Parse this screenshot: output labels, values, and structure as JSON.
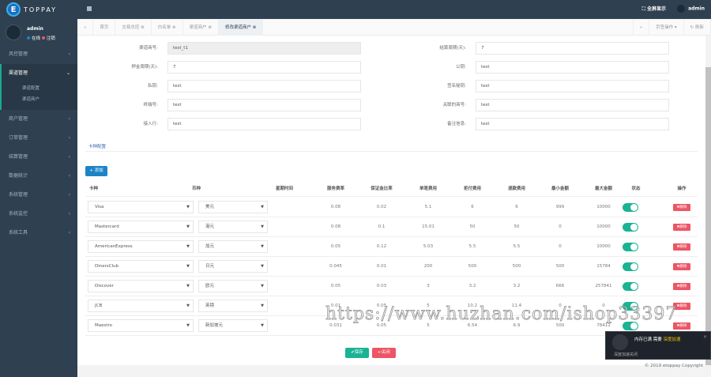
{
  "header": {
    "brand": "TOPPAY",
    "brand_letter": "E",
    "fullscreen": "⛶ 全屏显示",
    "user": "admin"
  },
  "sidebar": {
    "user": "admin",
    "online": "在线",
    "logout": "注销",
    "items": [
      {
        "label": "风控管理",
        "icon": "shield-icon"
      },
      {
        "label": "渠道管理",
        "icon": "card-icon",
        "children": [
          "渠道配置",
          "渠道商户"
        ]
      },
      {
        "label": "商户管理",
        "icon": "store-icon"
      },
      {
        "label": "订单管理",
        "icon": "cart-icon"
      },
      {
        "label": "结算管理",
        "icon": "calc-icon"
      },
      {
        "label": "数据统计",
        "icon": "chart-icon"
      },
      {
        "label": "系统管理",
        "icon": "gear-icon"
      },
      {
        "label": "系统监控",
        "icon": "monitor-icon"
      },
      {
        "label": "系统工具",
        "icon": "tool-icon"
      }
    ]
  },
  "tabs": {
    "items": [
      "首页",
      "交易总控",
      "白名单",
      "渠道商户",
      "修改渠道商户"
    ],
    "page_ops": "页签操作 ▾",
    "refresh": "↻ 刷新"
  },
  "form": {
    "left": [
      {
        "label": "渠道商号:",
        "value": "test_t1",
        "readonly": true
      },
      {
        "label": "押金周期(天):",
        "value": "7"
      },
      {
        "label": "私钥:",
        "value": "test"
      },
      {
        "label": "终端号:",
        "value": "test"
      },
      {
        "label": "接入行:",
        "value": "test"
      }
    ],
    "right": [
      {
        "label": "结算周期(天):",
        "value": "7"
      },
      {
        "label": "公钥:",
        "value": "test"
      },
      {
        "label": "签名秘钥:",
        "value": "test"
      },
      {
        "label": "关联的商号:",
        "value": "test"
      },
      {
        "label": "备注信息:",
        "value": "test"
      }
    ]
  },
  "card_config_link": "卡种配置",
  "add_button": "+ 添加",
  "table": {
    "columns": [
      "卡种",
      "币种",
      "星期时间",
      "服务费率",
      "保证金比率",
      "单笔费用",
      "拒付费用",
      "退款费用",
      "最小金额",
      "最大金额",
      "状态",
      "操作"
    ],
    "rows": [
      [
        "Visa",
        "美元",
        "0.08",
        "0.02",
        "5.1",
        "6",
        "6",
        "999",
        "10000"
      ],
      [
        "Mastercard",
        "港元",
        "0.08",
        "0.1",
        "15.01",
        "50",
        "50",
        "0",
        "10000"
      ],
      [
        "AmericanExpress",
        "加元",
        "0.05",
        "0.12",
        "5.03",
        "5.5",
        "5.5",
        "0",
        "10000"
      ],
      [
        "DinersClub",
        "日元",
        "0.045",
        "0.01",
        "200",
        "500",
        "500",
        "500",
        "15784"
      ],
      [
        "Discover",
        "欧元",
        "0.05",
        "0.03",
        "3",
        "3.2",
        "3.2",
        "666",
        "257841"
      ],
      [
        "JCB",
        "英镑",
        "0.01",
        "0.05",
        "5",
        "10.2",
        "11.4",
        "0",
        "0"
      ],
      [
        "Maestro",
        "新加坡元",
        "0.031",
        "0.05",
        "5",
        "6.54",
        "6.9",
        "500",
        "78412"
      ]
    ],
    "status_on": true,
    "delete_label": "✖删除"
  },
  "save_button": "✔保存",
  "close_button": "↩关闭",
  "footer": "© 2019 etoppay Copyright",
  "watermark": "https://www.huzhan.com/ishop33397",
  "popup": {
    "text": "内存已满 需要",
    "highlight": "深度加速",
    "sub": "深度加速关闭"
  },
  "colors": {
    "sidebar": "#2f4050",
    "primary": "#1c84c6",
    "success": "#1ab394",
    "danger": "#ed5565"
  }
}
